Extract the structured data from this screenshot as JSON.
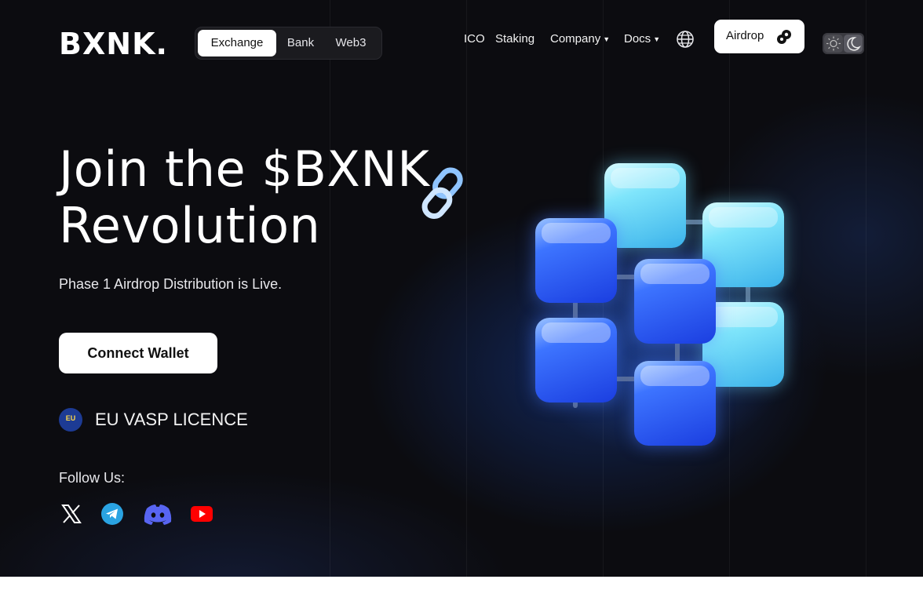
{
  "header": {
    "logo": "BXNK.",
    "segments": [
      "Exchange",
      "Bank",
      "Web3"
    ],
    "active_segment": "Exchange",
    "nav": {
      "ico": "ICO",
      "staking": "Staking",
      "company": "Company",
      "docs": "Docs"
    },
    "globe_icon": "globe-icon",
    "airdrop_label": "Airdrop",
    "airdrop_icon": "coins-icon",
    "theme_icons": [
      "sun-icon",
      "moon-icon"
    ]
  },
  "hero": {
    "title_line1": "Join the $BXNK",
    "title_line2": "Revolution",
    "subtitle": "Phase 1 Airdrop Distribution is Live.",
    "cta_label": "Connect Wallet",
    "licence_badge": "EU",
    "licence_text": "EU VASP LICENCE",
    "follow_label": "Follow Us:",
    "socials": [
      "x-icon",
      "telegram-icon",
      "discord-icon",
      "youtube-icon"
    ]
  },
  "colors": {
    "background": "#0c0c10",
    "accent_blue": "#1b3ee0",
    "accent_cyan": "#7fe5fb",
    "youtube_red": "#ff0000",
    "telegram_blue": "#2aa3e2",
    "discord_purple": "#5865f2"
  }
}
